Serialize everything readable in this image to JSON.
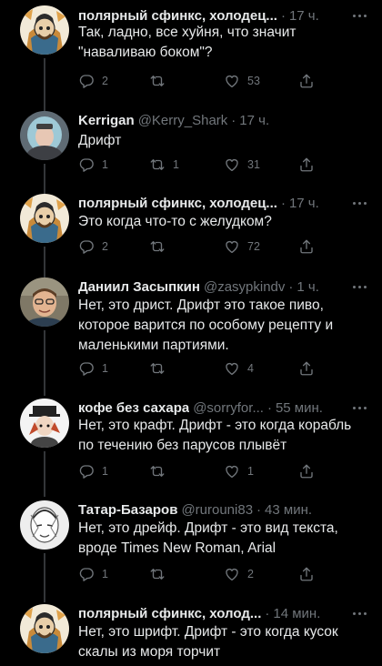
{
  "tweets": [
    {
      "name": "полярный сфинкс, холодец...",
      "handle": "",
      "time": "17 ч.",
      "text": "Так, ладно, все хуйня, что значит \"наваливаю боком\"?",
      "replies": "2",
      "retweets": "",
      "likes": "53",
      "avatar": "sphinx"
    },
    {
      "name": "Kerrigan",
      "handle": "@Kerry_Shark",
      "time": "17 ч.",
      "text": "Дрифт",
      "replies": "1",
      "retweets": "1",
      "likes": "31",
      "avatar": "cosplay"
    },
    {
      "name": "полярный сфинкс, холодец...",
      "handle": "",
      "time": "17 ч.",
      "text": "Это когда что-то с желудком?",
      "replies": "2",
      "retweets": "",
      "likes": "72",
      "avatar": "sphinx"
    },
    {
      "name": "Даниил Засыпкин",
      "handle": "@zasypkindv",
      "time": "1 ч.",
      "text": "Нет, это дрист. Дрифт это такое пиво, которое варится по особому рецепту и маленькими партиями.",
      "replies": "1",
      "retweets": "",
      "likes": "4",
      "avatar": "man"
    },
    {
      "name": "кофе без сахара",
      "handle": "@sorryfor...",
      "time": "55 мин.",
      "text": "Нет, это крафт. Дрифт - это когда корабль по течению без парусов плывёт",
      "replies": "1",
      "retweets": "",
      "likes": "1",
      "avatar": "drawing"
    },
    {
      "name": "Татар-Базаров",
      "handle": "@rurouni83",
      "time": "43 мин.",
      "text": "Нет, это дрейф. Дрифт - это вид текста, вроде Times New Roman, Arial",
      "replies": "1",
      "retweets": "",
      "likes": "2",
      "avatar": "sketch"
    },
    {
      "name": "полярный сфинкс, холод...",
      "handle": "",
      "time": "14 мин.",
      "text": "Нет, это шрифт. Дрифт - это когда кусок скалы из моря торчит",
      "replies": "",
      "retweets": "",
      "likes": "",
      "avatar": "sphinx"
    }
  ],
  "colors": {
    "background": "#000000",
    "text": "#e7e9ea",
    "secondary": "#71767b",
    "thread_line": "#333639"
  }
}
